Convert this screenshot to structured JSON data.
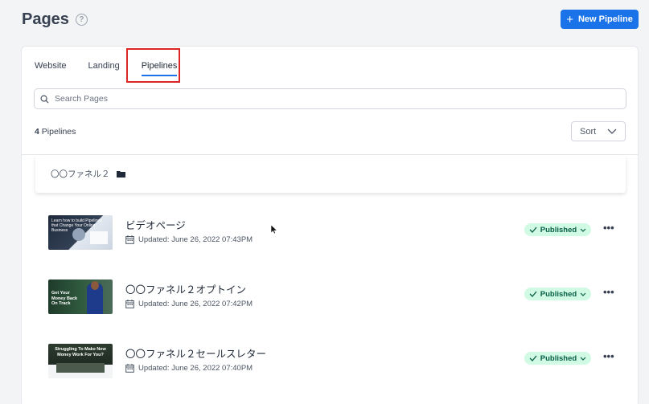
{
  "header": {
    "title": "Pages",
    "help_icon": "help-circle-icon",
    "new_button_label": "New Pipeline"
  },
  "tabs": [
    {
      "label": "Website",
      "active": false
    },
    {
      "label": "Landing",
      "active": false
    },
    {
      "label": "Pipelines",
      "active": true
    }
  ],
  "search": {
    "placeholder": "Search Pages",
    "value": ""
  },
  "summary": {
    "count": "4",
    "label": "Pipelines"
  },
  "sort": {
    "label": "Sort"
  },
  "folder": {
    "name": "〇〇ファネル２",
    "icon": "folder-icon"
  },
  "pages": [
    {
      "name": "ビデオページ",
      "updated": "Updated: June 26, 2022 07:43PM",
      "status": "Published",
      "thumb_text": "Learn how to build Pipelines that Change Your Online Business"
    },
    {
      "name": "〇〇ファネル２オプトイン",
      "updated": "Updated: June 26, 2022 07:42PM",
      "status": "Published",
      "thumb_text": "Get Your Money Back On Track"
    },
    {
      "name": "〇〇ファネル２セールスレター",
      "updated": "Updated: June 26, 2022 07:40PM",
      "status": "Published",
      "thumb_text": "Struggling To Make New Money Work For You?"
    }
  ],
  "colors": {
    "accent": "#1a73e8",
    "published_bg": "#d1fae5",
    "published_text": "#065f46",
    "highlight": "#dc2626"
  }
}
